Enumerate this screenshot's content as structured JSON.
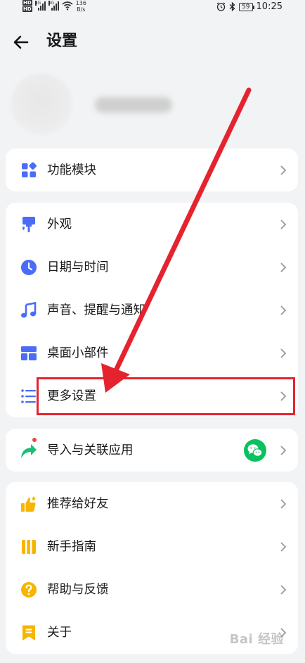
{
  "status_bar": {
    "hd_a": "HD",
    "hd_b": "HD",
    "net1": "4G",
    "net2": "4G",
    "speed_value": "136",
    "speed_unit": "B/s",
    "battery": "59",
    "time": "10:25"
  },
  "header": {
    "title": "设置"
  },
  "groups": [
    {
      "items": [
        {
          "label": "功能模块",
          "icon": "grid-blocks-icon"
        }
      ]
    },
    {
      "items": [
        {
          "label": "外观",
          "icon": "paint-roller-icon"
        },
        {
          "label": "日期与时间",
          "icon": "clock-icon"
        },
        {
          "label": "声音、提醒与通知",
          "icon": "music-note-icon"
        },
        {
          "label": "桌面小部件",
          "icon": "widget-icon"
        },
        {
          "label": "更多设置",
          "icon": "list-settings-icon"
        }
      ]
    },
    {
      "items": [
        {
          "label": "导入与关联应用",
          "icon": "share-arrow-icon",
          "badge": "wechat-icon"
        }
      ]
    },
    {
      "items": [
        {
          "label": "推荐给好友",
          "icon": "thumbs-up-icon"
        },
        {
          "label": "新手指南",
          "icon": "guide-book-icon"
        },
        {
          "label": "帮助与反馈",
          "icon": "help-icon"
        },
        {
          "label": "关于",
          "icon": "bookmark-icon"
        }
      ]
    }
  ],
  "colors": {
    "accent": "#4a6cf7",
    "highlight": "#e5232f",
    "wechat": "#0ac15f",
    "yellow": "#f7b500"
  },
  "watermark": "Bai 经验"
}
